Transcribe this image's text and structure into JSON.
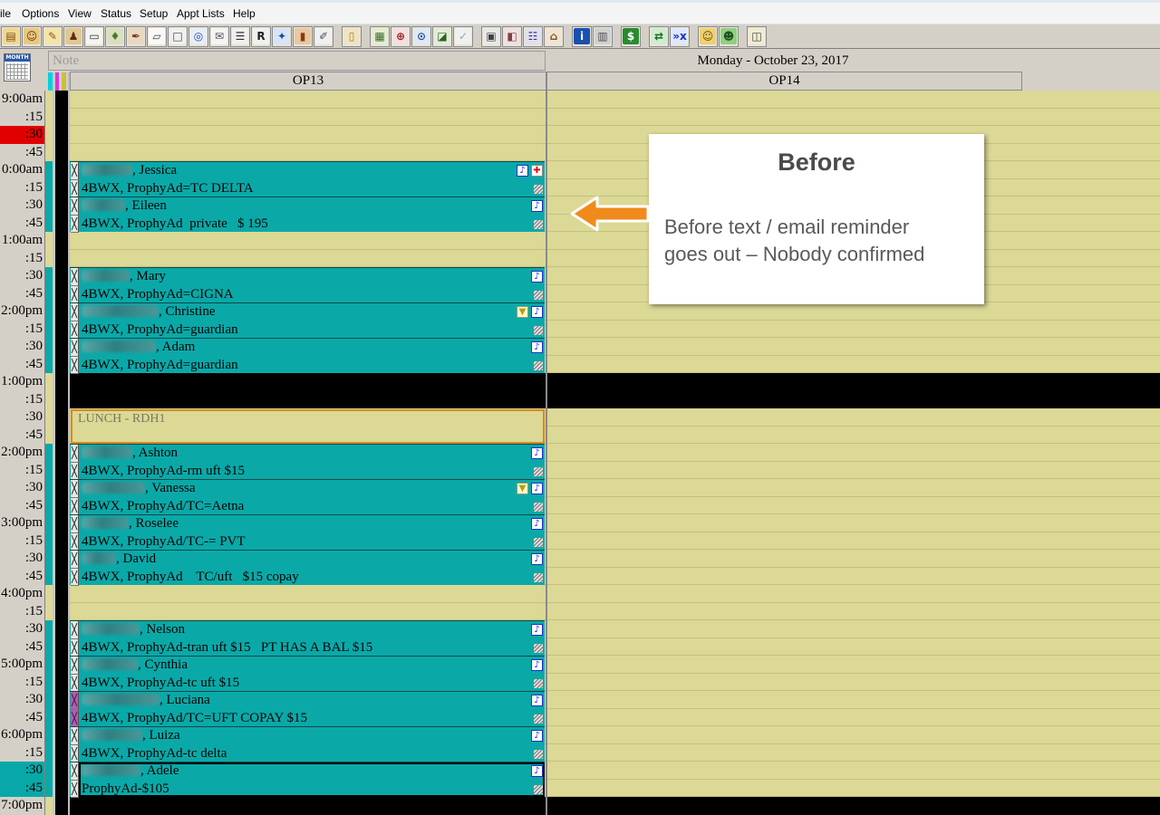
{
  "menu": {
    "items": [
      "ile",
      "Options",
      "View",
      "Status",
      "Setup",
      "Appt Lists",
      "Help"
    ]
  },
  "toolbar": {
    "groups": [
      [
        {
          "name": "appointment-book-icon",
          "glyph": "▤",
          "color": "#7a4a10",
          "bg": "#f0d890"
        },
        {
          "name": "family-icon",
          "glyph": "☺",
          "color": "#6a3a10",
          "bg": "#e8c880"
        },
        {
          "name": "notes-icon",
          "glyph": "✎",
          "color": "#8a5a10",
          "bg": "#f4e4a8"
        },
        {
          "name": "patient-icon",
          "glyph": "♟",
          "color": "#5a2a10",
          "bg": "#e0c890"
        },
        {
          "name": "id-card-icon",
          "glyph": "▭",
          "color": "#303030",
          "bg": "#f4f4f0"
        },
        {
          "name": "tooth-chart-icon",
          "glyph": "♦",
          "color": "#4a7a30",
          "bg": "#d8e0c0"
        },
        {
          "name": "pen-icon",
          "glyph": "✒",
          "color": "#803020",
          "bg": "#e8d8c0"
        },
        {
          "name": "blank-form-icon",
          "glyph": "▱",
          "color": "#404040",
          "bg": "#f8f8f8"
        },
        {
          "name": "form-icon",
          "glyph": "□",
          "color": "#404040",
          "bg": "#f0f0f0"
        },
        {
          "name": "form-search-icon",
          "glyph": "◎",
          "color": "#2050a0",
          "bg": "#e8eef8"
        },
        {
          "name": "envelope-icon",
          "glyph": "✉",
          "color": "#505050",
          "bg": "#f4f4f4"
        },
        {
          "name": "list-icon",
          "glyph": "☰",
          "color": "#303030",
          "bg": "#f0f0f0"
        },
        {
          "name": "rx-icon",
          "glyph": "R",
          "color": "#202020",
          "bg": "#f0f0f0"
        },
        {
          "name": "wand-icon",
          "glyph": "✦",
          "color": "#1050a0",
          "bg": "#d8e4f4"
        },
        {
          "name": "book-icon",
          "glyph": "▮",
          "color": "#8a3a10",
          "bg": "#e8c8a0"
        },
        {
          "name": "edit-icon",
          "glyph": "✐",
          "color": "#505050",
          "bg": "#f0f0f0"
        }
      ],
      [
        {
          "name": "clipboard-icon",
          "glyph": "▯",
          "color": "#a08040",
          "bg": "#f0e4c0"
        }
      ],
      [
        {
          "name": "chart-icon",
          "glyph": "▦",
          "color": "#3a6a2a",
          "bg": "#e4ecd0"
        },
        {
          "name": "zoom-tooth-icon",
          "glyph": "⊕",
          "color": "#a02020",
          "bg": "#f4e0e0"
        },
        {
          "name": "zoom-icon",
          "glyph": "⊙",
          "color": "#2050a0",
          "bg": "#e0e8f4"
        },
        {
          "name": "graph-icon",
          "glyph": "◪",
          "color": "#306020",
          "bg": "#e0ecd8"
        },
        {
          "name": "check-icon",
          "glyph": "✓",
          "color": "#a0a0a0",
          "bg": "#f0f0f0"
        }
      ],
      [
        {
          "name": "print-icon",
          "glyph": "▣",
          "color": "#404040",
          "bg": "#e8e8e8"
        },
        {
          "name": "fax-icon",
          "glyph": "◧",
          "color": "#804040",
          "bg": "#f0e0e0"
        },
        {
          "name": "contacts-icon",
          "glyph": "☷",
          "color": "#403080",
          "bg": "#e0e0f0"
        },
        {
          "name": "referral-icon",
          "glyph": "⌂",
          "color": "#805020",
          "bg": "#f0e4d0"
        }
      ],
      [
        {
          "name": "info-icon",
          "glyph": "i",
          "color": "#ffffff",
          "bg": "#1a50b0"
        },
        {
          "name": "trash-icon",
          "glyph": "▥",
          "color": "#505050",
          "bg": "#d0d0d0"
        }
      ],
      [
        {
          "name": "money-icon",
          "glyph": "$",
          "color": "#ffffff",
          "bg": "#2a8a30"
        }
      ],
      [
        {
          "name": "transfer-icon",
          "glyph": "⇄",
          "color": "#1a6a20",
          "bg": "#d0ecd0"
        },
        {
          "name": "send-x-icon",
          "glyph": "»x",
          "color": "#1030c0",
          "bg": "#e0e8ff"
        }
      ],
      [
        {
          "name": "staff-icon",
          "glyph": "☺",
          "color": "#6a4a10",
          "bg": "#f0d070"
        },
        {
          "name": "employee-icon",
          "glyph": "☻",
          "color": "#205020",
          "bg": "#90d080"
        }
      ],
      [
        {
          "name": "window-icon",
          "glyph": "◫",
          "color": "#404040",
          "bg": "#f0ecd0"
        }
      ]
    ]
  },
  "schedule": {
    "month_label": "MONTH",
    "note_label": "Note",
    "date": "Monday - October 23, 2017",
    "operatories": [
      "OP13",
      "OP14"
    ],
    "provider_colors": [
      "#00d0e0",
      "#e030d8",
      "#c8c040"
    ],
    "colors": {
      "open_slot": "#dcd896",
      "appointment": "#0aa9a8",
      "blocked": "#000000"
    },
    "time_labels": [
      "9:00am",
      ":15",
      ":30",
      ":45",
      "0:00am",
      ":15",
      ":30",
      ":45",
      "1:00am",
      ":15",
      ":30",
      ":45",
      "2:00pm",
      ":15",
      ":30",
      ":45",
      "1:00pm",
      ":15",
      ":30",
      ":45",
      "2:00pm",
      ":15",
      ":30",
      ":45",
      "3:00pm",
      ":15",
      ":30",
      ":45",
      "4:00pm",
      ":15",
      ":30",
      ":45",
      "5:00pm",
      ":15",
      ":30",
      ":45",
      "6:00pm",
      ":15",
      ":30",
      ":45",
      "7:00pm"
    ],
    "time_highlights": [
      {
        "start": "9:30",
        "end": "9:45",
        "color": "#e10000"
      },
      {
        "start": "18:30",
        "end": "19:00",
        "color": "#08a8a8"
      }
    ],
    "blocked": [
      {
        "start": "13:00",
        "end": "13:30"
      },
      {
        "start": "19:00",
        "end": "19:15"
      }
    ],
    "appointments": [
      {
        "type": "patient",
        "op": "OP13",
        "start": "10:00",
        "end": "10:30",
        "name_line": ", Jessica",
        "procedure": "4BWX, ProphyAd=TC DELTA",
        "icons": [
          "note-icon",
          "medical-alert-icon"
        ]
      },
      {
        "type": "patient",
        "op": "OP13",
        "start": "10:30",
        "end": "11:00",
        "name_line": ", Eileen",
        "procedure": "4BWX, ProphyAd  private   $ 195",
        "icons": [
          "note-icon"
        ]
      },
      {
        "type": "patient",
        "op": "OP13",
        "start": "11:30",
        "end": "12:00",
        "name_line": ", Mary",
        "procedure": "4BWX, ProphyAd=CIGNA",
        "icons": [
          "note-icon"
        ]
      },
      {
        "type": "patient",
        "op": "OP13",
        "start": "12:00",
        "end": "12:30",
        "name_line": ", Christine",
        "procedure": "4BWX, ProphyAd=guardian",
        "icons": [
          "filter-icon",
          "note-icon"
        ]
      },
      {
        "type": "patient",
        "op": "OP13",
        "start": "12:30",
        "end": "13:00",
        "name_line": ", Adam",
        "procedure": "4BWX, ProphyAd=guardian",
        "icons": [
          "note-icon"
        ]
      },
      {
        "type": "block",
        "op": "OP13",
        "start": "13:30",
        "end": "14:00",
        "label": "LUNCH - RDH1"
      },
      {
        "type": "patient",
        "op": "OP13",
        "start": "14:00",
        "end": "14:30",
        "name_line": ", Ashton",
        "procedure": "4BWX, ProphyAd-rm uft $15",
        "icons": [
          "note-icon"
        ]
      },
      {
        "type": "patient",
        "op": "OP13",
        "start": "14:30",
        "end": "15:00",
        "name_line": ", Vanessa",
        "procedure": "4BWX, ProphyAd/TC=Aetna",
        "icons": [
          "filter-icon",
          "note-icon"
        ]
      },
      {
        "type": "patient",
        "op": "OP13",
        "start": "15:00",
        "end": "15:30",
        "name_line": ", Roselee",
        "procedure": "4BWX, ProphyAd/TC-= PVT",
        "icons": [
          "note-icon"
        ]
      },
      {
        "type": "patient",
        "op": "OP13",
        "start": "15:30",
        "end": "16:00",
        "name_line": ", David",
        "procedure": "4BWX, ProphyAd    TC/uft   $15 copay",
        "icons": [
          "note-icon"
        ]
      },
      {
        "type": "patient",
        "op": "OP13",
        "start": "16:30",
        "end": "17:00",
        "name_line": ", Nelson",
        "procedure": "4BWX, ProphyAd-tran uft $15   PT HAS A BAL $15",
        "icons": [
          "note-icon"
        ]
      },
      {
        "type": "patient",
        "op": "OP13",
        "start": "17:00",
        "end": "17:30",
        "name_line": ", Cynthia",
        "procedure": "4BWX, ProphyAd-tc uft $15",
        "icons": [
          "note-icon"
        ]
      },
      {
        "type": "patient",
        "op": "OP13",
        "start": "17:30",
        "end": "18:00",
        "name_line": ", Luciana",
        "procedure": "4BWX, ProphyAd/TC=UFT COPAY $15",
        "icons": [
          "note-icon"
        ],
        "confirm_color": "#c850b8"
      },
      {
        "type": "patient",
        "op": "OP13",
        "start": "18:00",
        "end": "18:30",
        "name_line": ", Luiza",
        "procedure": "4BWX, ProphyAd-tc delta",
        "icons": [
          "note-icon"
        ]
      },
      {
        "type": "patient",
        "op": "OP13",
        "start": "18:30",
        "end": "19:00",
        "name_line": ", Adele",
        "procedure": "ProphyAd-$105",
        "icons": [
          "note-icon"
        ],
        "selected": true
      }
    ]
  },
  "callout": {
    "title": "Before",
    "lines": [
      "Before text / email reminder",
      "goes out – Nobody confirmed"
    ]
  }
}
